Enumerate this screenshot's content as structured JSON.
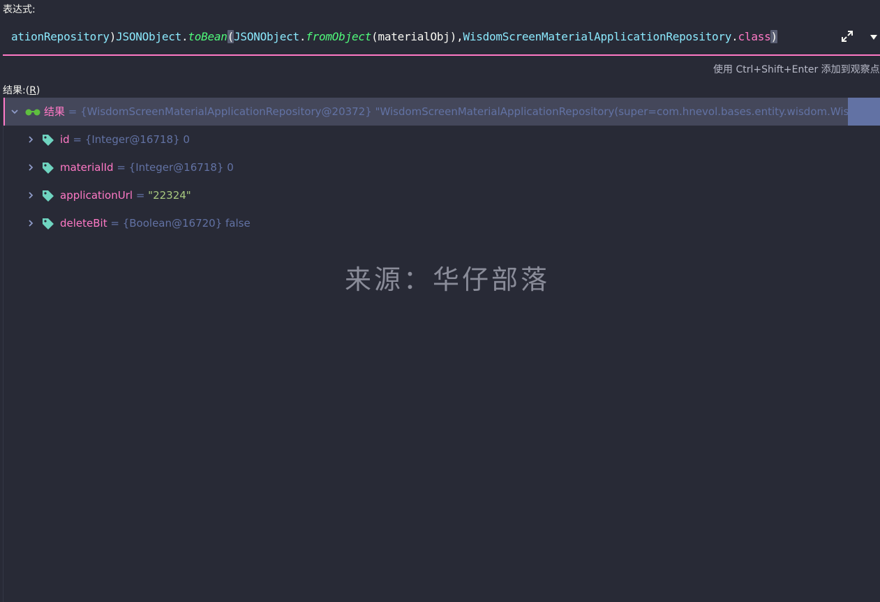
{
  "expression_label": "表达式:",
  "expression": {
    "tokens": [
      {
        "text": "ationRepository",
        "style": "cyan"
      },
      {
        "text": ")",
        "style": "plain"
      },
      {
        "text": "JSONObject",
        "style": "cyan"
      },
      {
        "text": ".",
        "style": "plain"
      },
      {
        "text": "toBean",
        "style": "green"
      },
      {
        "text": "(",
        "style": "paren"
      },
      {
        "text": "JSONObject",
        "style": "cyan"
      },
      {
        "text": ".",
        "style": "plain"
      },
      {
        "text": "fromObject",
        "style": "green"
      },
      {
        "text": "(materialObj),",
        "style": "plain"
      },
      {
        "text": "WisdomScreenMaterialApplicationRepository",
        "style": "cyan"
      },
      {
        "text": ".",
        "style": "plain"
      },
      {
        "text": "class",
        "style": "pink"
      },
      {
        "text": ")",
        "style": "paren"
      }
    ]
  },
  "hint": "使用 Ctrl+Shift+Enter 添加到观察点",
  "result_label": "结果:",
  "result_shortcut": "R",
  "result_label_paren_open": "(",
  "result_label_paren_close": ")",
  "tree": {
    "root": {
      "name": "结果",
      "eq": " = ",
      "value": "{WisdomScreenMaterialApplicationRepository@20372} \"WisdomScreenMaterialApplicationRepository(super=com.hnevol.bases.entity.wisdom.Wis"
    },
    "children": [
      {
        "name": "id",
        "eq": " = ",
        "value": "{Integer@16718} 0",
        "kind": "obj"
      },
      {
        "name": "materialId",
        "eq": " = ",
        "value": "{Integer@16718} 0",
        "kind": "obj"
      },
      {
        "name": "applicationUrl",
        "eq": " = ",
        "value": "\"22324\"",
        "kind": "str"
      },
      {
        "name": "deleteBit",
        "eq": " = ",
        "value": "{Boolean@16720} false",
        "kind": "obj"
      }
    ]
  },
  "watermark": "来源：华仔部落",
  "icons": {
    "expand": "expand-arrows-icon",
    "dropdown": "triangle-down-icon",
    "watch": "glasses-icon",
    "field": "tag-icon",
    "chevron": "chevron-icon"
  },
  "colors": {
    "background": "#282a36",
    "accent": "#ff79c6",
    "selection": "#44475a",
    "keyword_cyan": "#8be9fd",
    "method_green": "#50fa7b",
    "value_gray": "#6272a4",
    "string": "#a8c97f",
    "tag": "#6fd4c0"
  }
}
